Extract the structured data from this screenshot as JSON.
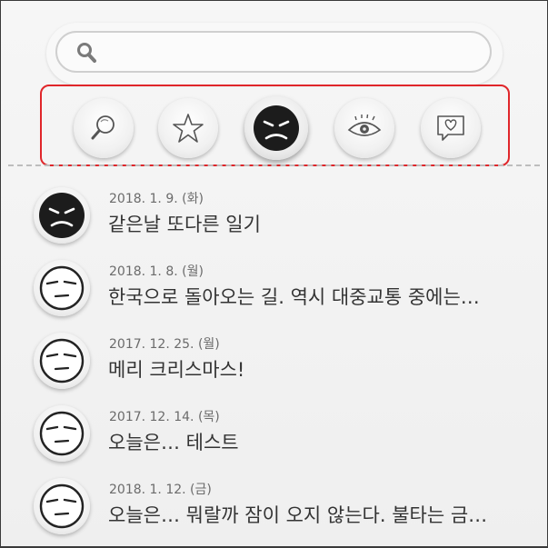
{
  "search": {
    "placeholder": ""
  },
  "filters": [
    {
      "icon": "magnifier-icon",
      "active": false
    },
    {
      "icon": "star-icon",
      "active": false
    },
    {
      "icon": "angry-face-icon",
      "active": true
    },
    {
      "icon": "eye-icon",
      "active": false
    },
    {
      "icon": "heart-speech-icon",
      "active": false
    }
  ],
  "entries": [
    {
      "date": "2018. 1. 9. (화)",
      "title": "같은날 또다른 일기",
      "mood": "angry-face-icon"
    },
    {
      "date": "2018. 1. 8. (월)",
      "title": "한국으로 돌아오는 길. 역시 대중교통 중에는…",
      "mood": "sleepy-face-icon"
    },
    {
      "date": "2017. 12. 25. (월)",
      "title": "메리 크리스마스!",
      "mood": "sleepy-face-icon"
    },
    {
      "date": "2017. 12. 14. (목)",
      "title": "오늘은… 테스트",
      "mood": "sleepy-face-icon"
    },
    {
      "date": "2018. 1. 12. (금)",
      "title": "오늘은… 뭐랄까 잠이 오지 않는다. 불타는 금…",
      "mood": "sleepy-face-icon"
    }
  ],
  "colors": {
    "highlight": "#e0262a",
    "background": "#f2f2f2"
  }
}
